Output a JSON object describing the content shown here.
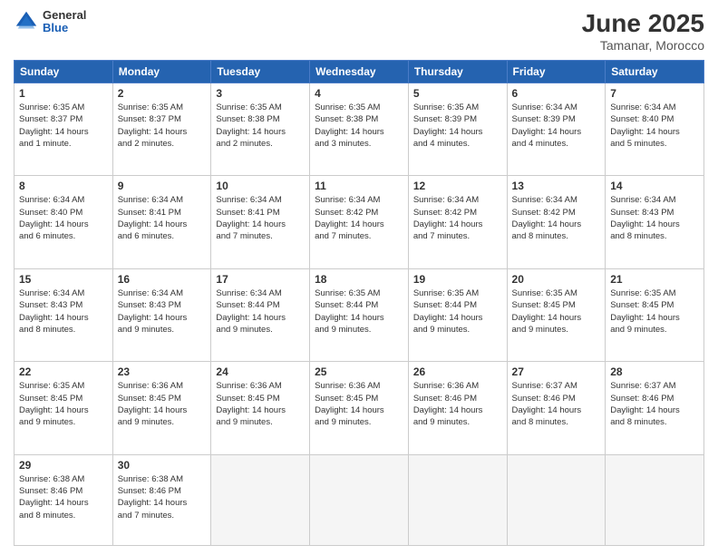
{
  "logo": {
    "general": "General",
    "blue": "Blue"
  },
  "title": "June 2025",
  "subtitle": "Tamanar, Morocco",
  "days_header": [
    "Sunday",
    "Monday",
    "Tuesday",
    "Wednesday",
    "Thursday",
    "Friday",
    "Saturday"
  ],
  "weeks": [
    [
      {
        "day": "1",
        "info": "Sunrise: 6:35 AM\nSunset: 8:37 PM\nDaylight: 14 hours\nand 1 minute."
      },
      {
        "day": "2",
        "info": "Sunrise: 6:35 AM\nSunset: 8:37 PM\nDaylight: 14 hours\nand 2 minutes."
      },
      {
        "day": "3",
        "info": "Sunrise: 6:35 AM\nSunset: 8:38 PM\nDaylight: 14 hours\nand 2 minutes."
      },
      {
        "day": "4",
        "info": "Sunrise: 6:35 AM\nSunset: 8:38 PM\nDaylight: 14 hours\nand 3 minutes."
      },
      {
        "day": "5",
        "info": "Sunrise: 6:35 AM\nSunset: 8:39 PM\nDaylight: 14 hours\nand 4 minutes."
      },
      {
        "day": "6",
        "info": "Sunrise: 6:34 AM\nSunset: 8:39 PM\nDaylight: 14 hours\nand 4 minutes."
      },
      {
        "day": "7",
        "info": "Sunrise: 6:34 AM\nSunset: 8:40 PM\nDaylight: 14 hours\nand 5 minutes."
      }
    ],
    [
      {
        "day": "8",
        "info": "Sunrise: 6:34 AM\nSunset: 8:40 PM\nDaylight: 14 hours\nand 6 minutes."
      },
      {
        "day": "9",
        "info": "Sunrise: 6:34 AM\nSunset: 8:41 PM\nDaylight: 14 hours\nand 6 minutes."
      },
      {
        "day": "10",
        "info": "Sunrise: 6:34 AM\nSunset: 8:41 PM\nDaylight: 14 hours\nand 7 minutes."
      },
      {
        "day": "11",
        "info": "Sunrise: 6:34 AM\nSunset: 8:42 PM\nDaylight: 14 hours\nand 7 minutes."
      },
      {
        "day": "12",
        "info": "Sunrise: 6:34 AM\nSunset: 8:42 PM\nDaylight: 14 hours\nand 7 minutes."
      },
      {
        "day": "13",
        "info": "Sunrise: 6:34 AM\nSunset: 8:42 PM\nDaylight: 14 hours\nand 8 minutes."
      },
      {
        "day": "14",
        "info": "Sunrise: 6:34 AM\nSunset: 8:43 PM\nDaylight: 14 hours\nand 8 minutes."
      }
    ],
    [
      {
        "day": "15",
        "info": "Sunrise: 6:34 AM\nSunset: 8:43 PM\nDaylight: 14 hours\nand 8 minutes."
      },
      {
        "day": "16",
        "info": "Sunrise: 6:34 AM\nSunset: 8:43 PM\nDaylight: 14 hours\nand 9 minutes."
      },
      {
        "day": "17",
        "info": "Sunrise: 6:34 AM\nSunset: 8:44 PM\nDaylight: 14 hours\nand 9 minutes."
      },
      {
        "day": "18",
        "info": "Sunrise: 6:35 AM\nSunset: 8:44 PM\nDaylight: 14 hours\nand 9 minutes."
      },
      {
        "day": "19",
        "info": "Sunrise: 6:35 AM\nSunset: 8:44 PM\nDaylight: 14 hours\nand 9 minutes."
      },
      {
        "day": "20",
        "info": "Sunrise: 6:35 AM\nSunset: 8:45 PM\nDaylight: 14 hours\nand 9 minutes."
      },
      {
        "day": "21",
        "info": "Sunrise: 6:35 AM\nSunset: 8:45 PM\nDaylight: 14 hours\nand 9 minutes."
      }
    ],
    [
      {
        "day": "22",
        "info": "Sunrise: 6:35 AM\nSunset: 8:45 PM\nDaylight: 14 hours\nand 9 minutes."
      },
      {
        "day": "23",
        "info": "Sunrise: 6:36 AM\nSunset: 8:45 PM\nDaylight: 14 hours\nand 9 minutes."
      },
      {
        "day": "24",
        "info": "Sunrise: 6:36 AM\nSunset: 8:45 PM\nDaylight: 14 hours\nand 9 minutes."
      },
      {
        "day": "25",
        "info": "Sunrise: 6:36 AM\nSunset: 8:45 PM\nDaylight: 14 hours\nand 9 minutes."
      },
      {
        "day": "26",
        "info": "Sunrise: 6:36 AM\nSunset: 8:46 PM\nDaylight: 14 hours\nand 9 minutes."
      },
      {
        "day": "27",
        "info": "Sunrise: 6:37 AM\nSunset: 8:46 PM\nDaylight: 14 hours\nand 8 minutes."
      },
      {
        "day": "28",
        "info": "Sunrise: 6:37 AM\nSunset: 8:46 PM\nDaylight: 14 hours\nand 8 minutes."
      }
    ],
    [
      {
        "day": "29",
        "info": "Sunrise: 6:38 AM\nSunset: 8:46 PM\nDaylight: 14 hours\nand 8 minutes."
      },
      {
        "day": "30",
        "info": "Sunrise: 6:38 AM\nSunset: 8:46 PM\nDaylight: 14 hours\nand 7 minutes."
      },
      {
        "day": "",
        "info": ""
      },
      {
        "day": "",
        "info": ""
      },
      {
        "day": "",
        "info": ""
      },
      {
        "day": "",
        "info": ""
      },
      {
        "day": "",
        "info": ""
      }
    ]
  ]
}
